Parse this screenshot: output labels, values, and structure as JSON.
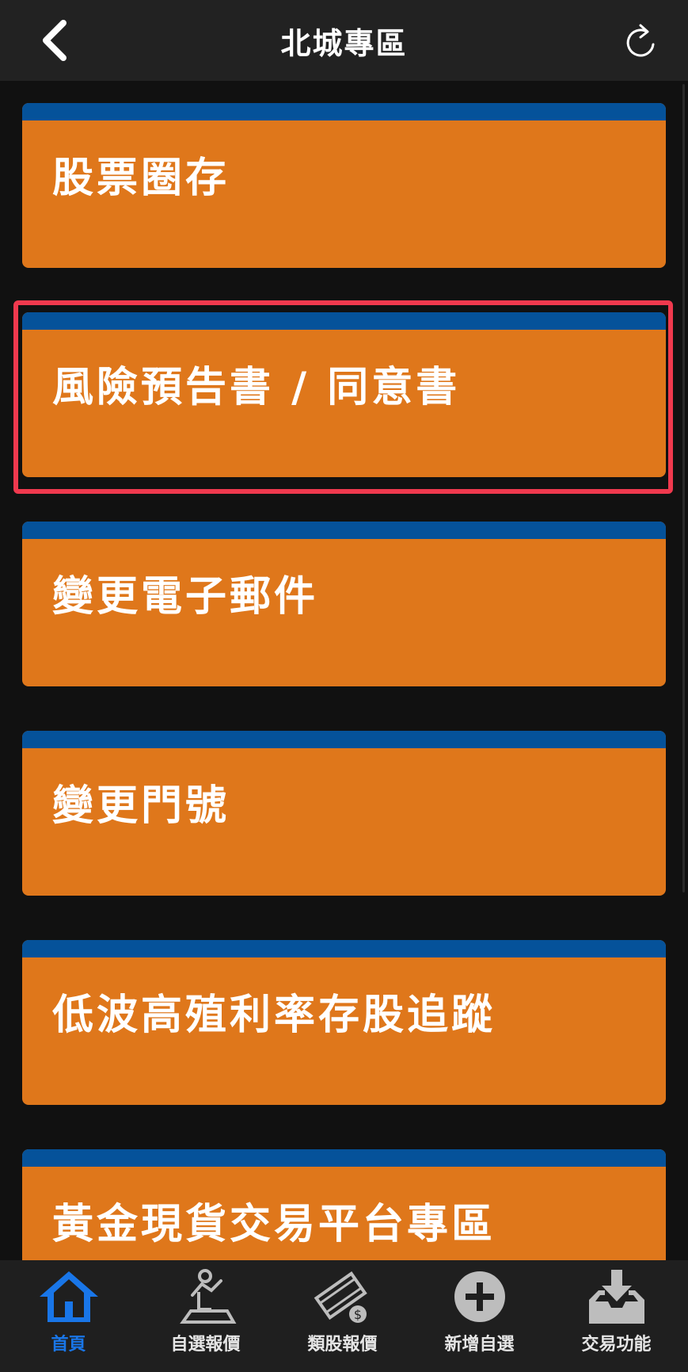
{
  "header": {
    "title": "北城專區"
  },
  "cards": [
    {
      "label": "股票圈存"
    },
    {
      "label": "風險預告書 / 同意書"
    },
    {
      "label": "變更電子郵件"
    },
    {
      "label": "變更門號"
    },
    {
      "label": "低波高殖利率存股追蹤"
    },
    {
      "label": "黃金現貨交易平台專區"
    }
  ],
  "tabs": [
    {
      "label": "首頁",
      "icon": "home-icon",
      "active": true
    },
    {
      "label": "自選報價",
      "icon": "user-chart-icon",
      "active": false
    },
    {
      "label": "類股報價",
      "icon": "film-dollar-icon",
      "active": false
    },
    {
      "label": "新增自選",
      "icon": "plus-circle-icon",
      "active": false
    },
    {
      "label": "交易功能",
      "icon": "download-tray-icon",
      "active": false
    }
  ],
  "colors": {
    "background": "#111111",
    "header": "#222222",
    "card": "#df771b",
    "card_stripe": "#05529a",
    "highlight": "#f0394e",
    "tab_active": "#1976e8"
  }
}
